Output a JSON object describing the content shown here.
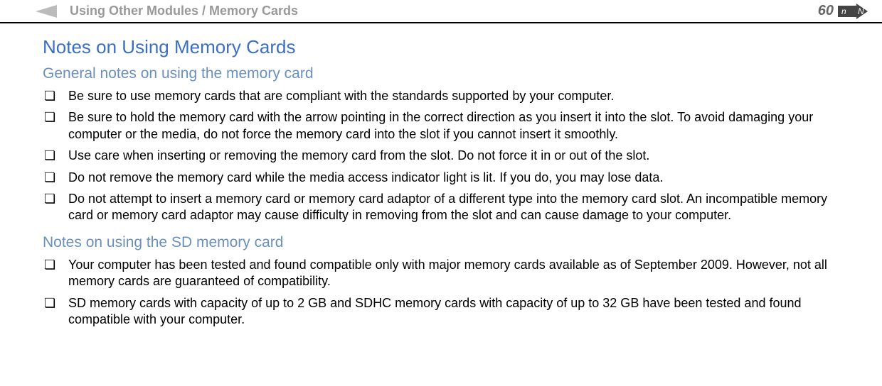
{
  "header": {
    "breadcrumb": "Using Other Modules / Memory Cards",
    "pageNumber": "60",
    "navLabel": "n N"
  },
  "content": {
    "title": "Notes on Using Memory Cards",
    "section1": {
      "heading": "General notes on using the memory card",
      "bullets": [
        "Be sure to use memory cards that are compliant with the standards supported by your computer.",
        "Be sure to hold the memory card with the arrow pointing in the correct direction as you insert it into the slot. To avoid damaging your computer or the media, do not force the memory card into the slot if you cannot insert it smoothly.",
        "Use care when inserting or removing the memory card from the slot. Do not force it in or out of the slot.",
        "Do not remove the memory card while the media access indicator light is lit. If you do, you may lose data.",
        "Do not attempt to insert a memory card or memory card adaptor of a different type into the memory card slot. An incompatible memory card or memory card adaptor may cause difficulty in removing from the slot and can cause damage to your computer."
      ]
    },
    "section2": {
      "heading": "Notes on using the SD memory card",
      "bullets": [
        "Your computer has been tested and found compatible only with major memory cards available as of September 2009. However, not all memory cards are guaranteed of compatibility.",
        "SD memory cards with capacity of up to 2 GB and SDHC memory cards with capacity of up to 32 GB have been tested and found compatible with your computer."
      ]
    }
  }
}
